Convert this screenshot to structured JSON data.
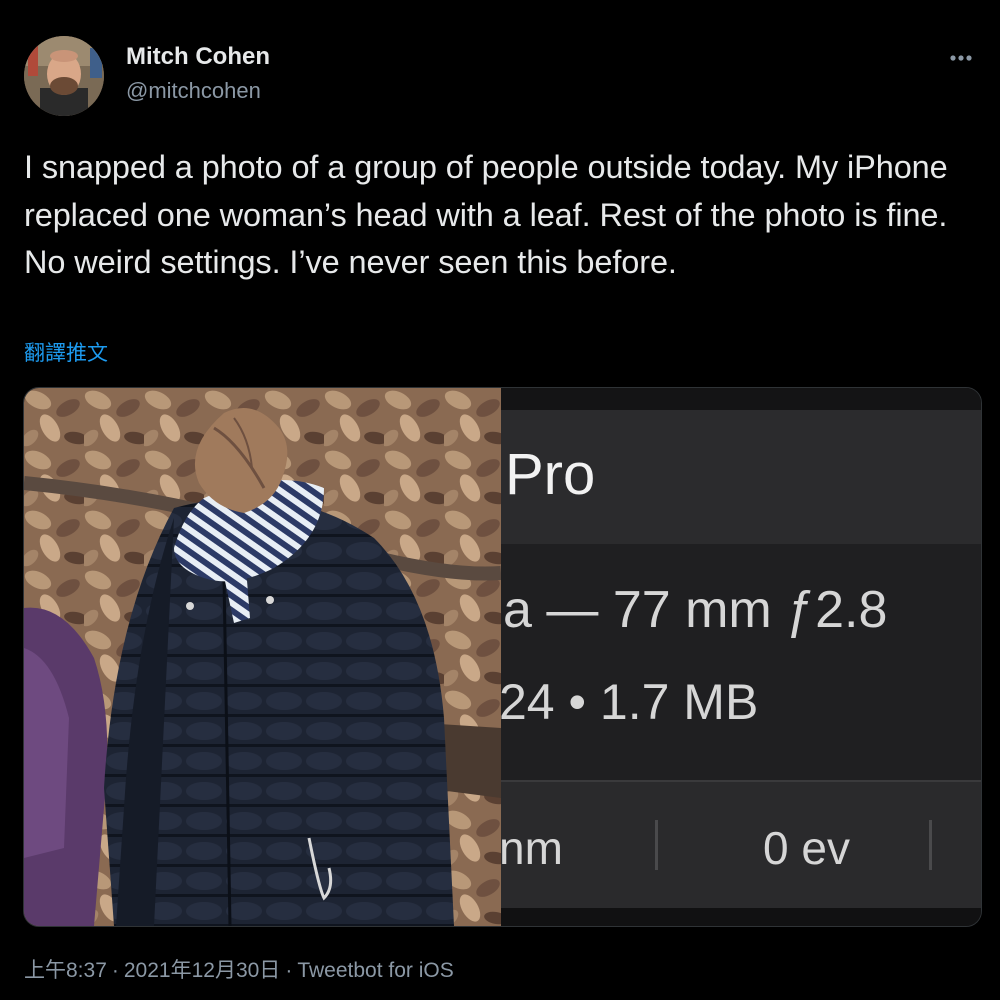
{
  "author": {
    "display_name": "Mitch Cohen",
    "handle": "@mitchcohen"
  },
  "more_menu_icon": "ellipsis-icon",
  "tweet": {
    "text": "I snapped a photo of a group of people outside today. My iPhone replaced one woman’s head with a leaf. Rest of the photo is fine. No weird settings. I’ve never seen this before.",
    "translate_label": "翻譯推文"
  },
  "media": {
    "info_panel": {
      "title_fragment": "Pro",
      "lens_fragment": "a — 77 mm ƒ2.8",
      "size_fragment": "24 • 1.7 MB",
      "focal_fragment": "nm",
      "ev_value": "0 ev"
    }
  },
  "meta": {
    "time": "上午8:37",
    "date": "2021年12月30日",
    "source": "Tweetbot for iOS",
    "separator": "·"
  },
  "colors": {
    "background": "#000000",
    "text": "#e7e9ea",
    "secondary_text": "#8b98a5",
    "link": "#1d9bf0"
  }
}
